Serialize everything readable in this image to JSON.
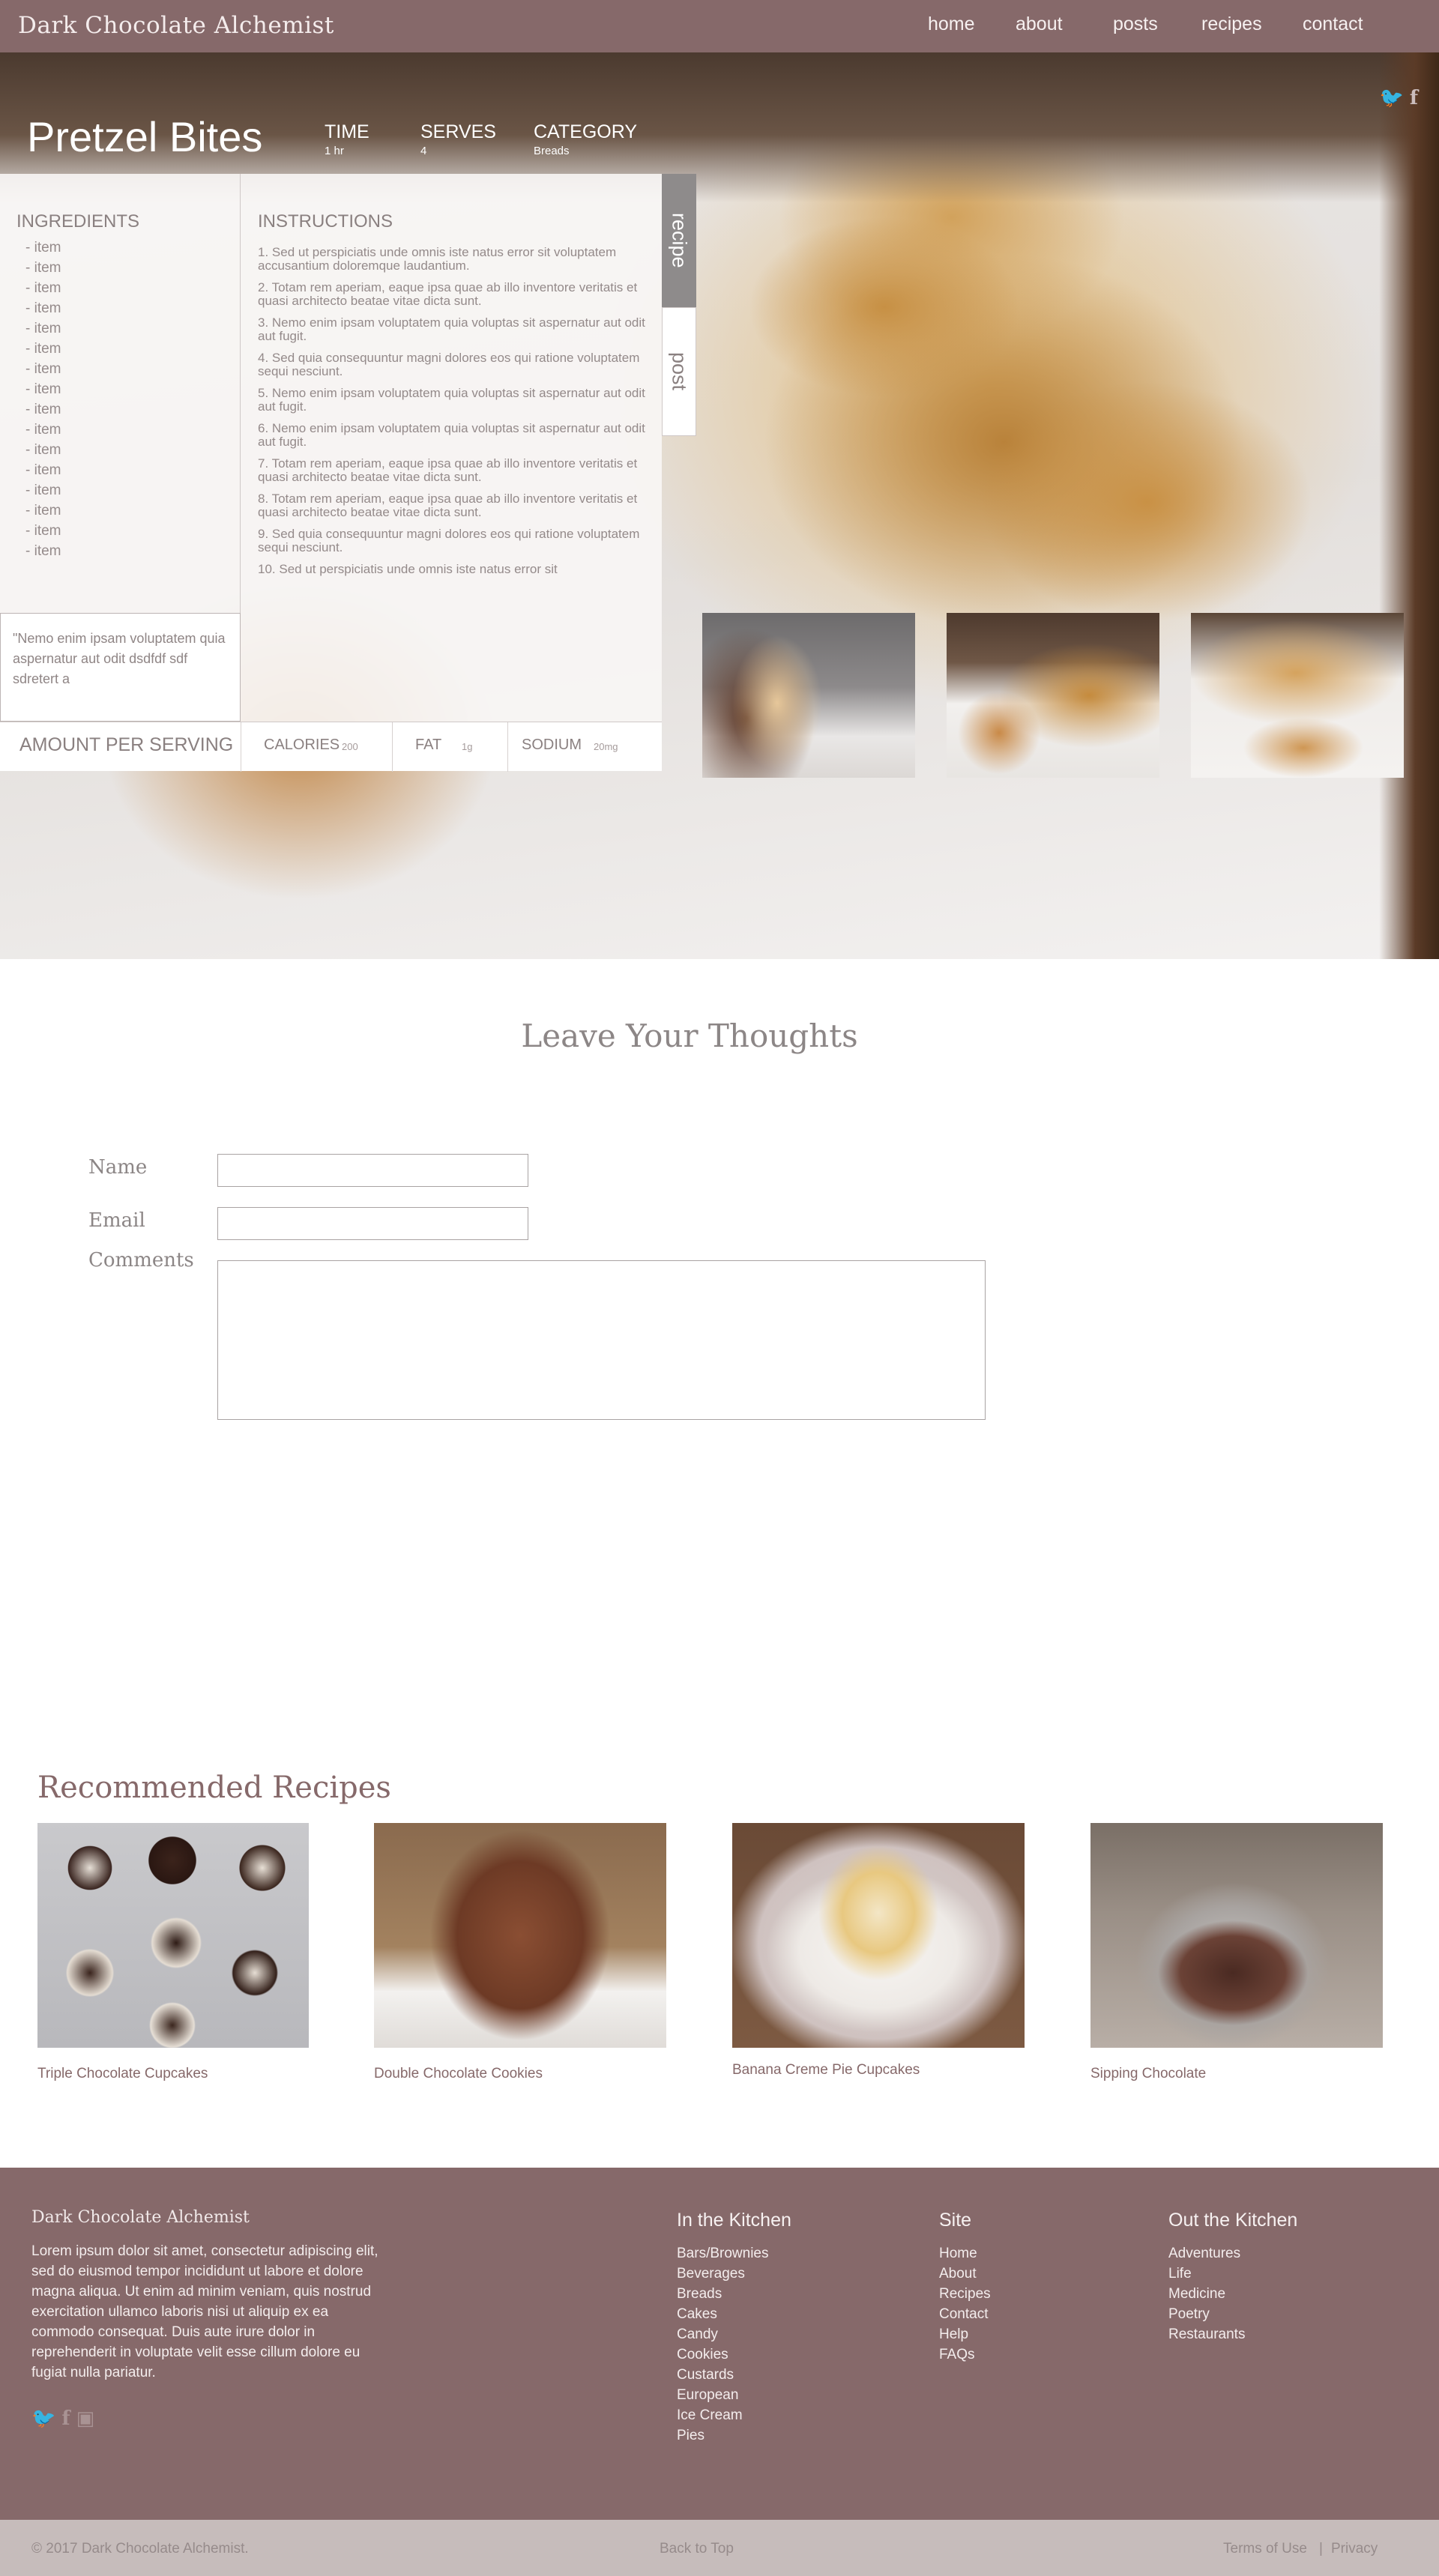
{
  "nav": {
    "brand": "Dark Chocolate Alchemist",
    "links": [
      "home",
      "about",
      "posts",
      "recipes",
      "contact"
    ]
  },
  "hero": {
    "social_icons": [
      "twitter-icon",
      "facebook-icon"
    ],
    "title": "Pretzel Bites",
    "meta": [
      {
        "label": "TIME",
        "value": "1 hr"
      },
      {
        "label": "SERVES",
        "value": "4"
      },
      {
        "label": "CATEGORY",
        "value": "Breads"
      }
    ],
    "ingredients_heading": "INGREDIENTS",
    "ingredients": [
      "- item",
      "- item",
      "- item",
      "- item",
      "- item",
      "- item",
      "- item",
      "- item",
      "- item",
      "- item",
      "- item",
      "- item",
      "- item",
      "- item",
      "- item",
      "- item"
    ],
    "quote": "\"Nemo enim ipsam voluptatem quia aspernatur aut odit dsdfdf sdf sdretert a",
    "instructions_heading": "INSTRUCTIONS",
    "instructions": [
      "1. Sed ut perspiciatis unde omnis iste natus error sit voluptatem accusantium doloremque laudantium.",
      "2. Totam rem aperiam, eaque ipsa quae ab illo inventore veritatis et quasi architecto beatae vitae dicta sunt.",
      "3. Nemo enim ipsam voluptatem quia voluptas sit aspernatur aut odit aut fugit.",
      "4. Sed quia consequuntur magni dolores eos qui ratione voluptatem sequi nesciunt.",
      "5. Nemo enim ipsam voluptatem quia voluptas sit aspernatur aut odit aut fugit.",
      "6. Nemo enim ipsam voluptatem quia voluptas sit aspernatur aut odit aut fugit.",
      "7. Totam rem aperiam, eaque ipsa quae ab illo inventore veritatis et quasi architecto beatae vitae dicta sunt.",
      "8. Totam rem aperiam, eaque ipsa quae ab illo inventore veritatis et quasi architecto beatae vitae dicta sunt.",
      "9. Sed quia consequuntur magni dolores eos qui ratione voluptatem sequi nesciunt.",
      "10. Sed ut perspiciatis unde omnis iste natus error sit"
    ],
    "nutrition": {
      "heading": "AMOUNT PER SERVING",
      "calories_label": "CALORIES",
      "calories_value": "200",
      "fat_label": "FAT",
      "fat_value": "1g",
      "sodium_label": "SODIUM",
      "sodium_value": "20mg"
    },
    "tabs": {
      "recipe": "recipe",
      "post": "post"
    }
  },
  "comments": {
    "heading": "Leave Your Thoughts",
    "name_label": "Name",
    "email_label": "Email",
    "comments_label": "Comments"
  },
  "recommended": {
    "heading": "Recommended Recipes",
    "items": [
      "Triple Chocolate Cupcakes",
      "Double Chocolate Cookies",
      "Banana Creme Pie Cupcakes",
      "Sipping Chocolate"
    ]
  },
  "footer": {
    "brand": "Dark Chocolate Alchemist",
    "about": "Lorem ipsum dolor sit amet, consectetur adipiscing elit, sed do eiusmod tempor incididunt ut labore et dolore magna aliqua. Ut enim ad minim veniam, quis nostrud exercitation ullamco laboris nisi ut aliquip ex ea commodo consequat. Duis aute irure dolor in reprehenderit in voluptate velit esse cillum dolore eu fugiat nulla pariatur.",
    "social_icons": [
      "twitter-icon",
      "facebook-icon",
      "instagram-icon"
    ],
    "kitchen": {
      "heading": "In the Kitchen",
      "items": [
        "Bars/Brownies",
        "Beverages",
        "Breads",
        "Cakes",
        "Candy",
        "Cookies",
        "Custards",
        "European",
        "Ice Cream",
        "Pies"
      ]
    },
    "site": {
      "heading": "Site",
      "items": [
        "Home",
        "About",
        "Recipes",
        "Contact",
        "Help",
        "FAQs"
      ]
    },
    "out": {
      "heading": "Out the Kitchen",
      "items": [
        "Adventures",
        "Life",
        "Medicine",
        "Poetry",
        "Restaurants"
      ]
    },
    "copyright": "© 2017 Dark Chocolate Alchemist.",
    "back_to_top": "Back to Top",
    "terms": "Terms of Use",
    "separator": "|",
    "privacy": "Privacy"
  }
}
